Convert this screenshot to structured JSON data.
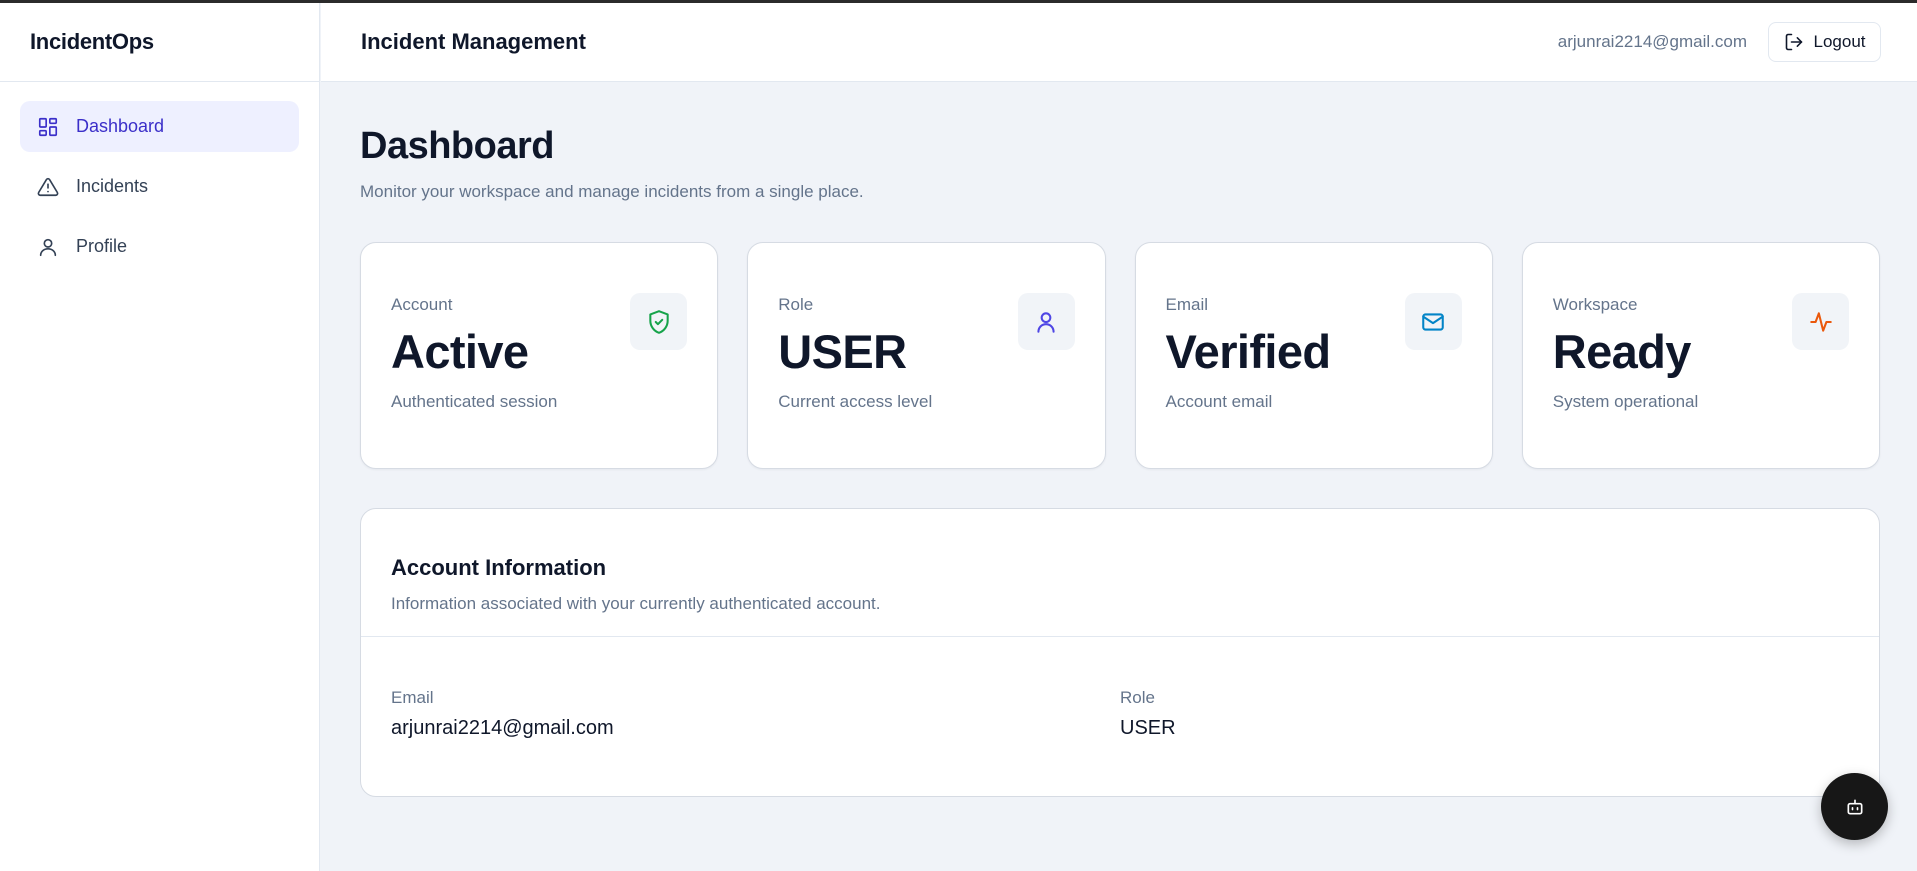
{
  "app": {
    "brand": "IncidentOps"
  },
  "sidebar": {
    "items": [
      {
        "label": "Dashboard",
        "icon": "dashboard-icon",
        "active": true
      },
      {
        "label": "Incidents",
        "icon": "alert-triangle-icon",
        "active": false
      },
      {
        "label": "Profile",
        "icon": "user-icon",
        "active": false
      }
    ]
  },
  "header": {
    "title": "Incident Management",
    "email": "arjunrai2214@gmail.com",
    "logout_label": "Logout"
  },
  "page": {
    "title": "Dashboard",
    "subtitle": "Monitor your workspace and manage incidents from a single place."
  },
  "cards": [
    {
      "label": "Account",
      "value": "Active",
      "sub": "Authenticated session",
      "icon": "shield-check-icon",
      "color": "#16a34a"
    },
    {
      "label": "Role",
      "value": "USER",
      "sub": "Current access level",
      "icon": "user-icon",
      "color": "#4f46e5"
    },
    {
      "label": "Email",
      "value": "Verified",
      "sub": "Account email",
      "icon": "mail-icon",
      "color": "#0284c7"
    },
    {
      "label": "Workspace",
      "value": "Ready",
      "sub": "System operational",
      "icon": "activity-icon",
      "color": "#ea580c"
    }
  ],
  "account_info": {
    "title": "Account Information",
    "description": "Information associated with your currently authenticated account.",
    "fields": [
      {
        "label": "Email",
        "value": "arjunrai2214@gmail.com"
      },
      {
        "label": "Role",
        "value": "USER"
      }
    ]
  },
  "fab": {
    "icon": "bot-icon"
  },
  "colors": {
    "accent": "#3b2fc9",
    "accent_bg": "#eef0ff",
    "page_bg": "#f0f3f8"
  }
}
